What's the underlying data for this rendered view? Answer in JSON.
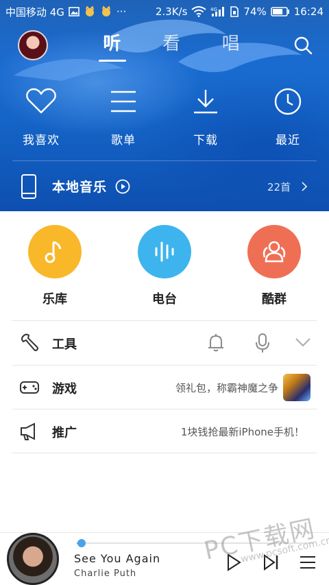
{
  "status_bar": {
    "carrier": "中国移动 4G",
    "extra_dots": "···",
    "speed": "2.3K/s",
    "net_badge": "4G",
    "battery_percent": "74%",
    "battery_level": 0.74,
    "time": "16:24"
  },
  "nav": {
    "tabs": [
      {
        "label": "听",
        "active": true
      },
      {
        "label": "看",
        "active": false
      },
      {
        "label": "唱",
        "active": false
      }
    ]
  },
  "quick_actions": [
    {
      "label": "我喜欢",
      "icon": "heart-icon"
    },
    {
      "label": "歌单",
      "icon": "list-icon"
    },
    {
      "label": "下载",
      "icon": "download-icon"
    },
    {
      "label": "最近",
      "icon": "clock-icon"
    }
  ],
  "local_music": {
    "label": "本地音乐",
    "count": "22首"
  },
  "features": [
    {
      "label": "乐库",
      "color": "#f9b72a",
      "icon": "music-note-icon"
    },
    {
      "label": "电台",
      "color": "#3db4ee",
      "icon": "radio-wave-icon"
    },
    {
      "label": "酷群",
      "color": "#ef6f55",
      "icon": "group-icon"
    }
  ],
  "rows": {
    "tools": {
      "label": "工具"
    },
    "games": {
      "label": "游戏",
      "note": "领礼包，称霸神魔之争"
    },
    "promo": {
      "label": "推广",
      "note": "1块钱抢最新iPhone手机！"
    }
  },
  "player": {
    "title": "See You Again",
    "artist": "Charlie Puth",
    "progress": 0.02
  },
  "watermark": {
    "main": "PC下载网",
    "sub": "www.pcsoft.com.cn"
  },
  "colors": {
    "hero_blue": "#1a6bd0",
    "accent": "#4aa3e8"
  }
}
